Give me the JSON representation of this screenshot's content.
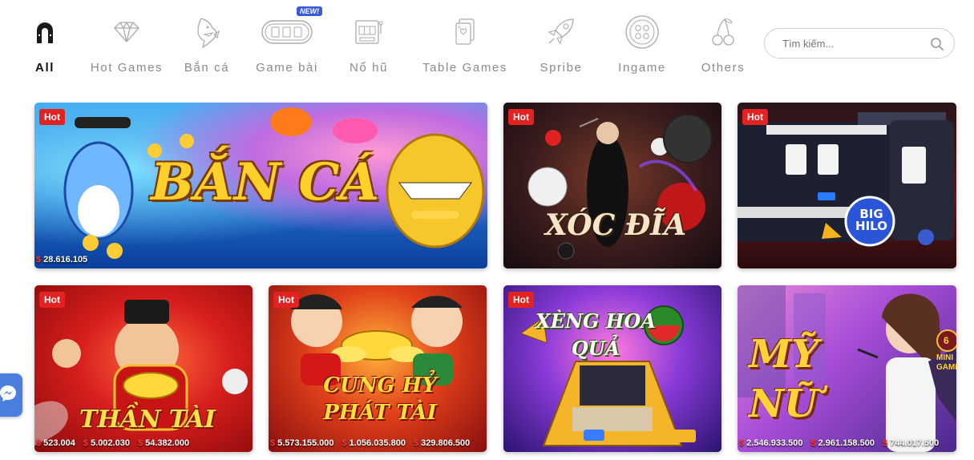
{
  "nav": {
    "categories": [
      {
        "label": "All",
        "icon": "horseshoe-icon",
        "active": true
      },
      {
        "label": "Hot Games",
        "icon": "diamond-icon"
      },
      {
        "label": "Bắn cá",
        "icon": "shark-icon"
      },
      {
        "label": "Game bài",
        "icon": "card-table-icon",
        "badge": "NEW!"
      },
      {
        "label": "Nổ hũ",
        "icon": "slot-machine-icon"
      },
      {
        "label": "Table Games",
        "icon": "playing-card-icon"
      },
      {
        "label": "Spribe",
        "icon": "rocket-icon"
      },
      {
        "label": "Ingame",
        "icon": "mahjong-chip-icon"
      },
      {
        "label": "Others",
        "icon": "cherries-icon"
      }
    ],
    "search_placeholder": "Tìm kiếm...",
    "search_icon": "search-icon"
  },
  "games": [
    {
      "title": "BẮN CÁ",
      "badge": "Hot",
      "jackpots": [
        "28.616.105"
      ]
    },
    {
      "title": "XÓC ĐĨA",
      "badge": "Hot",
      "jackpots": []
    },
    {
      "title": "BIG HILO",
      "badge": "Hot",
      "jackpots": []
    },
    {
      "title": "THẦN TÀI",
      "badge": "Hot",
      "jackpots": [
        "523.004",
        "5.002.030",
        "54.382.000"
      ]
    },
    {
      "title": "CUNG HỶ PHÁT TÀI",
      "badge": "Hot",
      "jackpots": [
        "5.573.155.000",
        "1.056.035.800",
        "329.806.500"
      ]
    },
    {
      "title": "XÈNG HOA QUẢ",
      "badge": "Hot",
      "jackpots": []
    },
    {
      "title": "MỸ NỮ",
      "badge": "",
      "jackpots": [
        "2.546.933.500",
        "2.961.158.500",
        "744.017.500"
      ]
    }
  ],
  "extra": {
    "mini_game_label": "MINI GAME",
    "mini_game_count": "6"
  },
  "colors": {
    "hot_badge": "#e52222",
    "jackpot_dollar": "#ff3b3b",
    "messenger": "#4a7fe0"
  }
}
